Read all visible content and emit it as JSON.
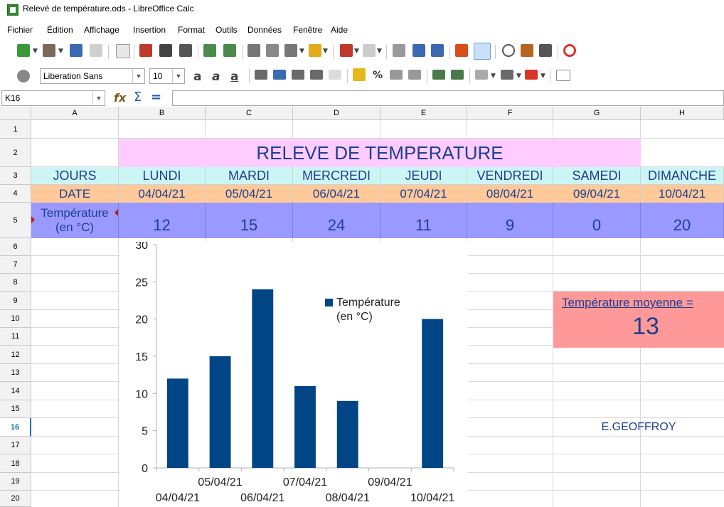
{
  "window": {
    "title": "Relevé de température.ods - LibreOffice Calc"
  },
  "menu": [
    "Fichier",
    "Édition",
    "Affichage",
    "Insertion",
    "Format",
    "Outils",
    "Données",
    "Fenêtre",
    "Aide"
  ],
  "toolbar": {
    "font_name": "Liberation Sans",
    "font_size": "10"
  },
  "formula_bar": {
    "name_box": "K16",
    "content": ""
  },
  "columns": [
    "A",
    "B",
    "C",
    "D",
    "E",
    "F",
    "G",
    "H"
  ],
  "rows": [
    "1",
    "2",
    "3",
    "4",
    "5",
    "6",
    "7",
    "8",
    "9",
    "10",
    "11",
    "12",
    "13",
    "14",
    "15",
    "16",
    "17",
    "18",
    "19",
    "20"
  ],
  "selected_row": "16",
  "sheet": {
    "title": "RELEVE DE TEMPERATURE",
    "jours_label": "JOURS",
    "date_label": "DATE",
    "temp_label_line1": "Température",
    "temp_label_line2": "(en °C)",
    "days": [
      "LUNDI",
      "MARDI",
      "MERCREDI",
      "JEUDI",
      "VENDREDI",
      "SAMEDI",
      "DIMANCHE"
    ],
    "dates": [
      "04/04/21",
      "05/04/21",
      "06/04/21",
      "07/04/21",
      "08/04/21",
      "09/04/21",
      "10/04/21"
    ],
    "temps": [
      "12",
      "15",
      "24",
      "11",
      "9",
      "0",
      "20"
    ],
    "average_label": "Température moyenne =",
    "average_value": "13",
    "author": "E.GEOFFROY"
  },
  "colors": {
    "title_bg": "#ffccff",
    "day_bg": "#ccf5f5",
    "date_bg": "#ffc99a",
    "temp_bg": "#9999ff",
    "avg_bg": "#ff9999",
    "bar": "#004586"
  },
  "chart_data": {
    "type": "bar",
    "categories": [
      "04/04/21",
      "05/04/21",
      "06/04/21",
      "07/04/21",
      "08/04/21",
      "09/04/21",
      "10/04/21"
    ],
    "series": [
      {
        "name": "Température (en °C)",
        "values": [
          12,
          15,
          24,
          11,
          9,
          0,
          20
        ]
      }
    ],
    "legend_line1": "Température",
    "legend_line2": "(en °C)",
    "yticks": [
      "0",
      "5",
      "10",
      "15",
      "20",
      "25",
      "30"
    ],
    "ylim": [
      0,
      30
    ],
    "grid": false,
    "legend": "top-right"
  }
}
